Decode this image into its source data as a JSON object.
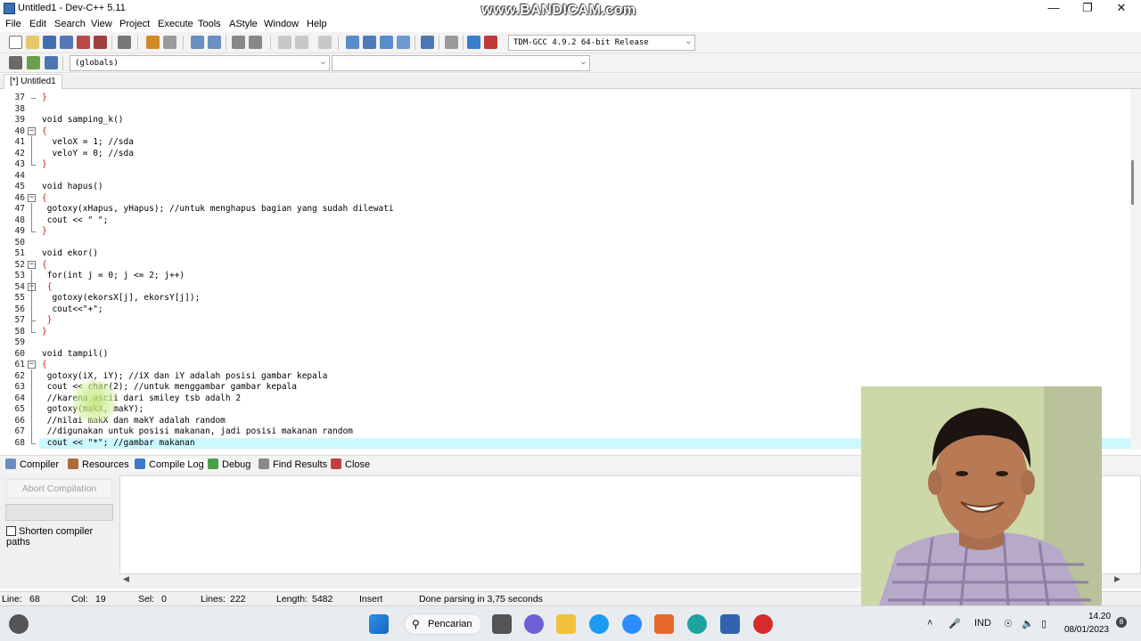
{
  "window": {
    "title": "Untitled1 - Dev-C++ 5.11",
    "watermark": "www.BANDICAM.com",
    "minimize": "—",
    "maximize": "❐",
    "close": "✕"
  },
  "menu": [
    "File",
    "Edit",
    "Search",
    "View",
    "Project",
    "Execute",
    "Tools",
    "AStyle",
    "Window",
    "Help"
  ],
  "toolbar": {
    "compiler_select": "TDM-GCC 4.9.2 64-bit Release",
    "scope_select": "(globals)",
    "function_select": ""
  },
  "tab": {
    "label": "[*] Untitled1"
  },
  "editor": {
    "lines": [
      {
        "n": "37",
        "text": "}"
      },
      {
        "n": "38",
        "text": ""
      },
      {
        "n": "39",
        "text": "void samping_k()"
      },
      {
        "n": "40",
        "text": "{"
      },
      {
        "n": "41",
        "text": "  veloX = 1; //sda"
      },
      {
        "n": "42",
        "text": "  veloY = 0; //sda"
      },
      {
        "n": "43",
        "text": "}"
      },
      {
        "n": "44",
        "text": ""
      },
      {
        "n": "45",
        "text": "void hapus()"
      },
      {
        "n": "46",
        "text": "{"
      },
      {
        "n": "47",
        "text": " gotoxy(xHapus, yHapus); //untuk menghapus bagian yang sudah dilewati"
      },
      {
        "n": "48",
        "text": " cout << \" \";"
      },
      {
        "n": "49",
        "text": "}"
      },
      {
        "n": "50",
        "text": ""
      },
      {
        "n": "51",
        "text": "void ekor()"
      },
      {
        "n": "52",
        "text": "{"
      },
      {
        "n": "53",
        "text": " for(int j = 0; j <= 2; j++)"
      },
      {
        "n": "54",
        "text": " {"
      },
      {
        "n": "55",
        "text": "  gotoxy(ekorsX[j], ekorsY[j]);"
      },
      {
        "n": "56",
        "text": "  cout<<\"+\";"
      },
      {
        "n": "57",
        "text": " }"
      },
      {
        "n": "58",
        "text": "}"
      },
      {
        "n": "59",
        "text": ""
      },
      {
        "n": "60",
        "text": "void tampil()"
      },
      {
        "n": "61",
        "text": "{"
      },
      {
        "n": "62",
        "text": " gotoxy(iX, iY); //iX dan iY adalah posisi gambar kepala"
      },
      {
        "n": "63",
        "text": " cout << char(2); //untuk menggambar gambar kepala"
      },
      {
        "n": "64",
        "text": " //karena ascii dari smiley tsb adalh 2"
      },
      {
        "n": "65",
        "text": " gotoxy(makX, makY);"
      },
      {
        "n": "66",
        "text": " //nilai makX dan makY adalah random"
      },
      {
        "n": "67",
        "text": " //digunakan untuk posisi makanan, jadi posisi makanan random"
      },
      {
        "n": "68",
        "text": " cout << \"*\"; //gambar makanan"
      }
    ]
  },
  "bottom_tabs": [
    "Compiler",
    "Resources",
    "Compile Log",
    "Debug",
    "Find Results",
    "Close"
  ],
  "compile_panel": {
    "abort_button": "Abort Compilation",
    "shorten_label": "Shorten compiler paths"
  },
  "status": {
    "line": "Line:",
    "line_val": "68",
    "col": "Col:",
    "col_val": "19",
    "sel": "Sel:",
    "sel_val": "0",
    "lines": "Lines:",
    "lines_val": "222",
    "length": "Length:",
    "length_val": "5482",
    "mode": "Insert",
    "message": "Done parsing in 3,75 seconds"
  },
  "taskbar": {
    "search_label": "Pencarian",
    "lang": "IND",
    "time": "14.20",
    "date": "08/01/2023",
    "notif": "8"
  }
}
